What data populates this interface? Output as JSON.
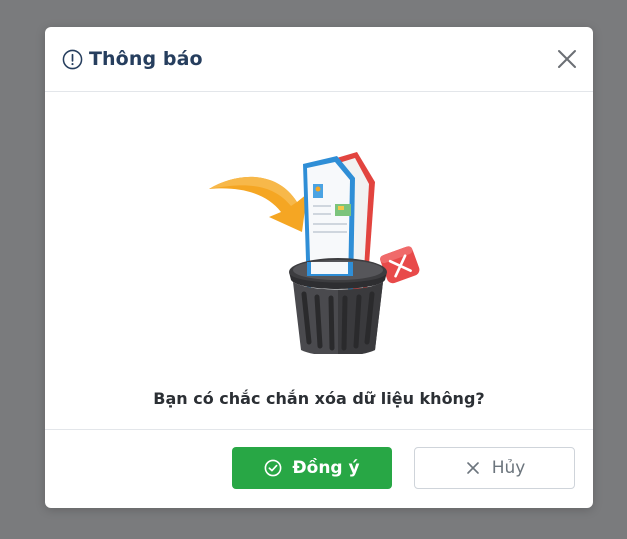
{
  "dialog": {
    "title": "Thông báo",
    "header_icon": "info-circle-icon",
    "close_icon": "close-icon",
    "illustration": "trash-bin-with-documents-icon",
    "message": "Bạn có chắc chắn xóa dữ liệu không?"
  },
  "buttons": {
    "confirm_label": "Đồng ý",
    "confirm_icon": "check-circle-icon",
    "cancel_label": "Hủy",
    "cancel_icon": "x-icon"
  },
  "colors": {
    "overlay": "#7a7b7d",
    "title": "#263e5e",
    "confirm_bg": "#28a745",
    "cancel_text": "#6c757d"
  }
}
